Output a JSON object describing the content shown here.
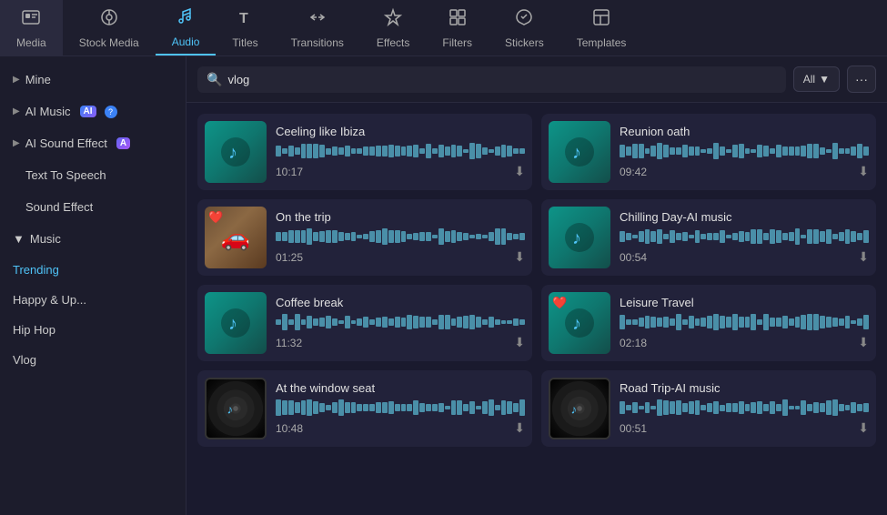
{
  "nav": {
    "items": [
      {
        "id": "media",
        "label": "Media",
        "icon": "🎞"
      },
      {
        "id": "stock-media",
        "label": "Stock Media",
        "icon": "📷"
      },
      {
        "id": "audio",
        "label": "Audio",
        "icon": "🎵",
        "active": true
      },
      {
        "id": "titles",
        "label": "Titles",
        "icon": "𝐓"
      },
      {
        "id": "transitions",
        "label": "Transitions",
        "icon": "↔"
      },
      {
        "id": "effects",
        "label": "Effects",
        "icon": "✦"
      },
      {
        "id": "filters",
        "label": "Filters",
        "icon": "⊞"
      },
      {
        "id": "stickers",
        "label": "Stickers",
        "icon": "⭐"
      },
      {
        "id": "templates",
        "label": "Templates",
        "icon": "▦"
      }
    ]
  },
  "sidebar": {
    "mine_label": "Mine",
    "ai_music_label": "AI Music",
    "ai_sound_effect_label": "AI Sound Effect",
    "text_to_speech_label": "Text To Speech",
    "sound_effect_label": "Sound Effect",
    "music_label": "Music",
    "music_sub": [
      {
        "id": "trending",
        "label": "Trending",
        "active": true
      },
      {
        "id": "happy",
        "label": "Happy & Up..."
      },
      {
        "id": "hip-hop",
        "label": "Hip Hop"
      },
      {
        "id": "vlog",
        "label": "Vlog"
      }
    ]
  },
  "search": {
    "placeholder": "vlog",
    "value": "vlog",
    "filter_label": "All",
    "more_label": "···"
  },
  "tracks": [
    {
      "id": "t1",
      "title": "Ceeling like Ibiza",
      "duration": "10:17",
      "thumb_type": "teal_note",
      "heart": false
    },
    {
      "id": "t2",
      "title": "Reunion oath",
      "duration": "09:42",
      "thumb_type": "teal_note",
      "heart": false
    },
    {
      "id": "t3",
      "title": "On the trip",
      "duration": "01:25",
      "thumb_type": "photo_car",
      "heart": true
    },
    {
      "id": "t4",
      "title": "Chilling Day-AI music",
      "duration": "00:54",
      "thumb_type": "teal_note",
      "heart": false
    },
    {
      "id": "t5",
      "title": "Coffee break",
      "duration": "11:32",
      "thumb_type": "teal_note",
      "heart": false
    },
    {
      "id": "t6",
      "title": "Leisure Travel",
      "duration": "02:18",
      "thumb_type": "teal_note",
      "heart": true
    },
    {
      "id": "t7",
      "title": "At the window seat",
      "duration": "10:48",
      "thumb_type": "dark_vinyl",
      "heart": false
    },
    {
      "id": "t8",
      "title": "Road Trip-AI music",
      "duration": "00:51",
      "thumb_type": "dark_vinyl2",
      "heart": false
    }
  ],
  "icons": {
    "chevron_right": "▶",
    "chevron_down": "▼",
    "search": "🔍",
    "download": "⬇",
    "music_note": "♪"
  }
}
